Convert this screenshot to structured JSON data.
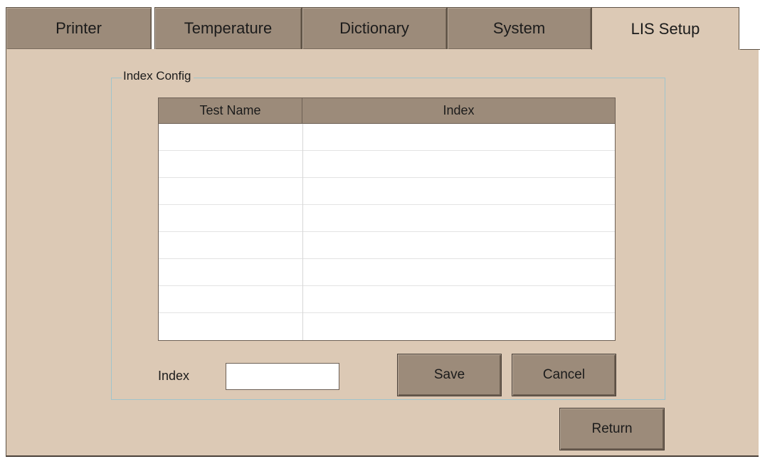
{
  "tabs": [
    {
      "label": "Printer",
      "active": false
    },
    {
      "label": "Temperature",
      "active": false
    },
    {
      "label": "Dictionary",
      "active": false
    },
    {
      "label": "System",
      "active": false
    },
    {
      "label": "LIS Setup",
      "active": true
    }
  ],
  "group": {
    "title": "Index Config"
  },
  "table": {
    "columns": [
      "Test Name",
      "Index"
    ],
    "rows": [
      [
        "",
        ""
      ],
      [
        "",
        ""
      ],
      [
        "",
        ""
      ],
      [
        "",
        ""
      ],
      [
        "",
        ""
      ],
      [
        "",
        ""
      ],
      [
        "",
        ""
      ],
      [
        "",
        ""
      ]
    ]
  },
  "index_field": {
    "label": "Index",
    "value": "",
    "placeholder": ""
  },
  "buttons": {
    "save": "Save",
    "cancel": "Cancel",
    "return": "Return"
  },
  "colors": {
    "panel_bg": "#dcc9b5",
    "tab_bg": "#9c8b7a",
    "button_bg": "#9c8b7a",
    "groupbox_border": "#9fc4cc"
  }
}
